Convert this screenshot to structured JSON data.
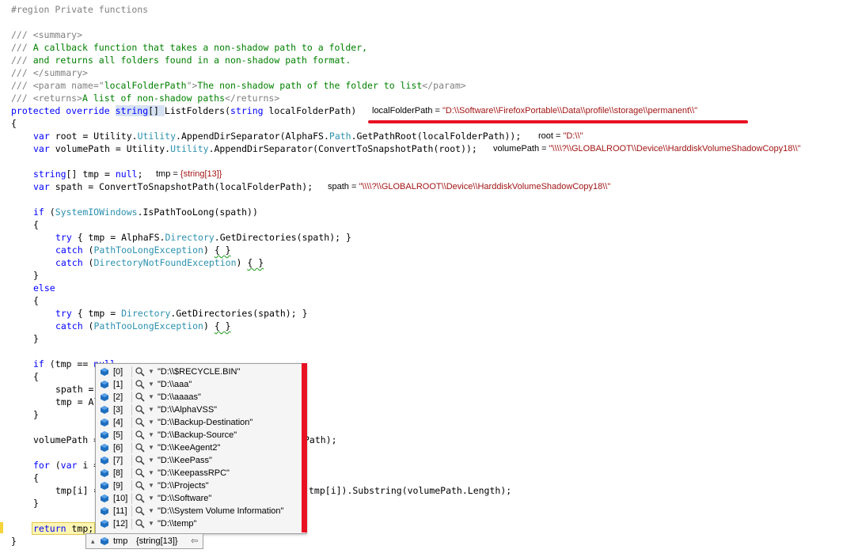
{
  "code": {
    "region": "#region Private functions",
    "c1": "/// <summary>",
    "c2a": "/// ",
    "c2b": "A callback function that takes a non-shadow path to a folder,",
    "c3a": "/// ",
    "c3b": "and returns all folders found in a non-shadow path format.",
    "c4": "/// </summary>",
    "c5a": "/// <param name=\"",
    "c5b": "localFolderPath",
    "c5c": "\">",
    "c5d": "The non-shadow path of the folder to list",
    "c5e": "</param>",
    "c6a": "/// <returns>",
    "c6b": "A list of non-shadow paths",
    "c6c": "</returns>",
    "sig_protected": "protected",
    "sig_override": "override",
    "sig_string": "string",
    "sig_rest1": "[] ",
    "sig_name": "ListFolders",
    "sig_open": "(",
    "sig_string2": "string",
    "sig_param": " localFolderPath)",
    "brace_open": "{",
    "brace_close": "}",
    "l_root_var": "var",
    "l_root_a": " root = Utility.",
    "l_root_b": "Utility",
    "l_root_c": ".AppendDirSeparator(AlphaFS.",
    "l_root_d": "Path",
    "l_root_e": ".GetPathRoot(localFolderPath));",
    "l_vp_var": "var",
    "l_vp_a": " volumePath = Utility.",
    "l_vp_b": "Utility",
    "l_vp_c": ".AppendDirSeparator(ConvertToSnapshotPath(root));",
    "l_tmp_string": "string",
    "l_tmp_a": "[] tmp = ",
    "l_tmp_null": "null",
    "l_tmp_b": ";",
    "l_sp_var": "var",
    "l_sp_a": " spath = ConvertToSnapshotPath(localFolderPath);",
    "if1_if": "if",
    "if1_a": " (",
    "if1_type": "SystemIOWindows",
    "if1_b": ".IsPathTooLong(spath))",
    "try1_try": "try",
    "try1_a": " { tmp = AlphaFS.",
    "try1_type": "Directory",
    "try1_b": ".GetDirectories(spath); }",
    "catch_kw": "catch",
    "catch1_type": "PathTooLongException",
    "catch2_type": "DirectoryNotFoundException",
    "catch_open": " (",
    "catch_close": ") ",
    "empty_block": "{ }",
    "else_kw": "else",
    "try2_try": "try",
    "try2_a": " { tmp = ",
    "try2_type": "Directory",
    "try2_b": ".GetDirectories(spath); }",
    "if2_if": "if",
    "if2_a": " (tmp == ",
    "if2_null": "null",
    "spath_line": "spath = ",
    "tmp_line": "tmp = Al",
    "vp2_a": "volumePath = ",
    "vp2_b": "Path);",
    "for_for": "for",
    "for_a": " (",
    "for_var": "var",
    "for_b": " i = ",
    "tmpi_a": "tmp[i] = ",
    "tmpi_b": "tmp[i]).Substring(volumePath.Length);",
    "ret_kw": "return",
    "ret_a": " tmp;"
  },
  "datatips": {
    "localFolderPath": {
      "name": "localFolderPath",
      "eq": " = ",
      "value": "\"D:\\\\Software\\\\FirefoxPortable\\\\Data\\\\profile\\\\storage\\\\permanent\\\\\""
    },
    "root": {
      "name": "root",
      "eq": " = ",
      "value": "\"D:\\\\\""
    },
    "volumePath": {
      "name": "volumePath",
      "eq": " = ",
      "value": "\"\\\\\\\\?\\\\GLOBALROOT\\\\Device\\\\HarddiskVolumeShadowCopy18\\\\\""
    },
    "tmp": {
      "name": "tmp",
      "eq": " = ",
      "value": "{string[13]}"
    },
    "spath": {
      "name": "spath",
      "eq": " = ",
      "value": "\"\\\\\\\\?\\\\GLOBALROOT\\\\Device\\\\HarddiskVolumeShadowCopy18\\\\\""
    }
  },
  "popup": {
    "items": [
      {
        "index": "[0]",
        "value": "\"D:\\\\$RECYCLE.BIN\""
      },
      {
        "index": "[1]",
        "value": "\"D:\\\\aaa\""
      },
      {
        "index": "[2]",
        "value": "\"D:\\\\aaaas\""
      },
      {
        "index": "[3]",
        "value": "\"D:\\\\AlphaVSS\""
      },
      {
        "index": "[4]",
        "value": "\"D:\\\\Backup-Destination\""
      },
      {
        "index": "[5]",
        "value": "\"D:\\\\Backup-Source\""
      },
      {
        "index": "[6]",
        "value": "\"D:\\\\KeeAgent2\""
      },
      {
        "index": "[7]",
        "value": "\"D:\\\\KeePass\""
      },
      {
        "index": "[8]",
        "value": "\"D:\\\\KeepassRPC\""
      },
      {
        "index": "[9]",
        "value": "\"D:\\\\Projects\""
      },
      {
        "index": "[10]",
        "value": "\"D:\\\\Software\""
      },
      {
        "index": "[11]",
        "value": "\"D:\\\\System Volume Information\""
      },
      {
        "index": "[12]",
        "value": "\"D:\\\\temp\""
      }
    ]
  },
  "tip": {
    "expand": "▴",
    "name": "tmp",
    "value": "{string[13]}",
    "pin": "⇦"
  },
  "colors": {
    "keyword": "#0000ff",
    "type": "#2b91af",
    "comment": "#008000",
    "value": "#a31515",
    "annotation": "#e81123"
  },
  "icons": [
    "field-cube-icon",
    "magnifier-icon",
    "dropdown-arrow-icon",
    "pin-icon"
  ]
}
